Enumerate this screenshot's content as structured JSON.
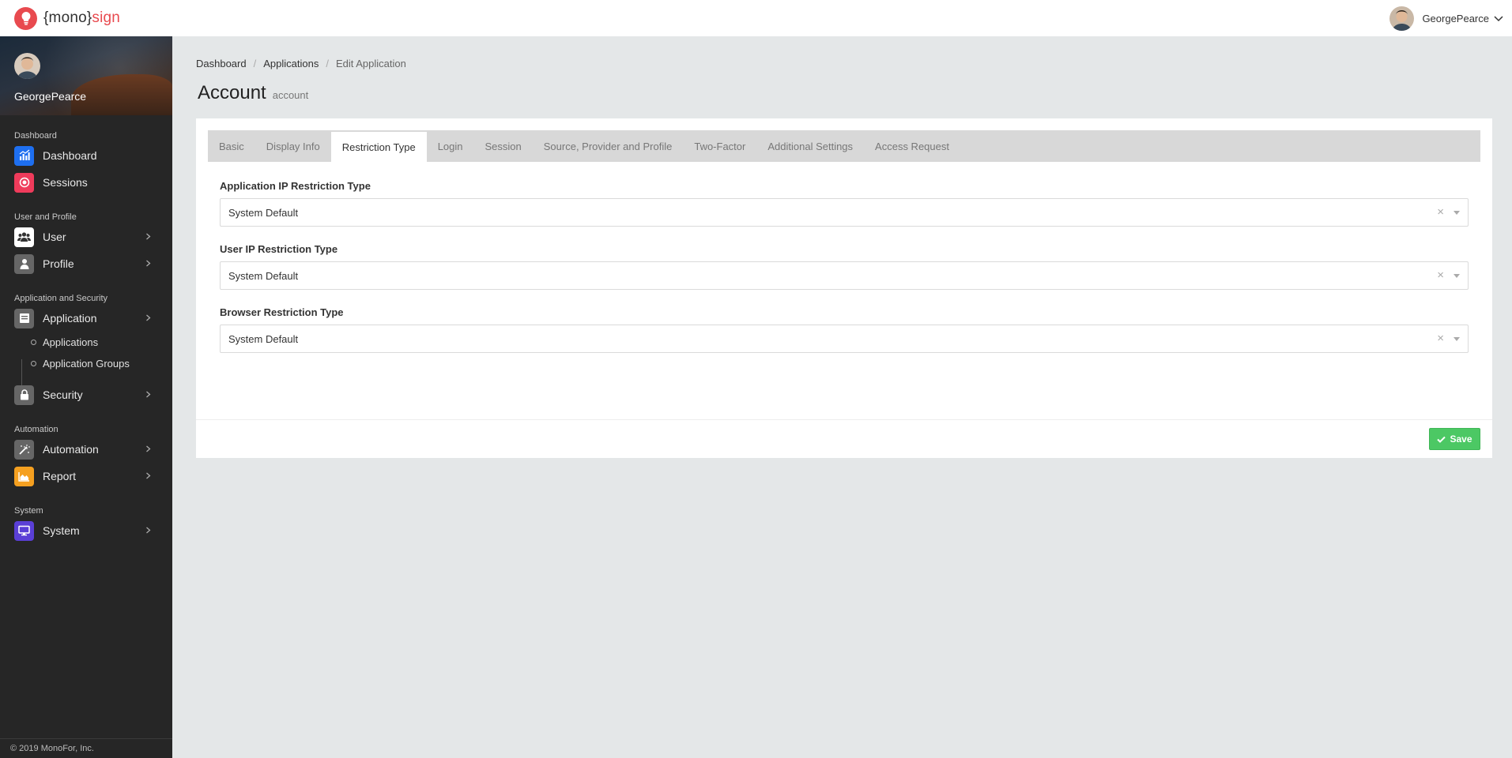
{
  "topbar": {
    "brand_mono": "{mono}",
    "brand_sign": "sign",
    "username": "GeorgePearce"
  },
  "sidebar": {
    "username": "GeorgePearce",
    "sections": [
      {
        "title": "Dashboard"
      },
      {
        "title": "User and Profile"
      },
      {
        "title": "Application and Security"
      },
      {
        "title": "Automation"
      },
      {
        "title": "System"
      }
    ],
    "items": {
      "dashboard": {
        "label": "Dashboard",
        "icon": "chart-icon",
        "color": "#1e6ff0"
      },
      "sessions": {
        "label": "Sessions",
        "icon": "record-icon",
        "color": "#ef3b5b"
      },
      "user": {
        "label": "User",
        "icon": "users-icon",
        "color": "#ffffff"
      },
      "profile": {
        "label": "Profile",
        "icon": "person-icon",
        "color": "#666666"
      },
      "application": {
        "label": "Application",
        "icon": "window-icon",
        "color": "#666666"
      },
      "applications": {
        "label": "Applications"
      },
      "application_groups": {
        "label": "Application Groups"
      },
      "security": {
        "label": "Security",
        "icon": "lock-icon",
        "color": "#666666"
      },
      "automation": {
        "label": "Automation",
        "icon": "magic-wand-icon",
        "color": "#666666"
      },
      "report": {
        "label": "Report",
        "icon": "area-chart-icon",
        "color": "#f5a020"
      },
      "system": {
        "label": "System",
        "icon": "monitor-icon",
        "color": "#5a3fd6"
      }
    },
    "footer": "© 2019 MonoFor, Inc."
  },
  "breadcrumb": [
    "Dashboard",
    "Applications",
    "Edit Application"
  ],
  "page": {
    "title": "Account",
    "subtitle": "account"
  },
  "tabs": [
    "Basic",
    "Display Info",
    "Restriction Type",
    "Login",
    "Session",
    "Source, Provider and Profile",
    "Two-Factor",
    "Additional Settings",
    "Access Request"
  ],
  "active_tab": "Restriction Type",
  "form": {
    "app_ip": {
      "label": "Application IP Restriction Type",
      "value": "System Default",
      "clear": "×"
    },
    "user_ip": {
      "label": "User IP Restriction Type",
      "value": "System Default",
      "clear": "×"
    },
    "browser": {
      "label": "Browser Restriction Type",
      "value": "System Default",
      "clear": "×"
    }
  },
  "actions": {
    "save_label": "Save",
    "save_color": "#4cc864"
  }
}
